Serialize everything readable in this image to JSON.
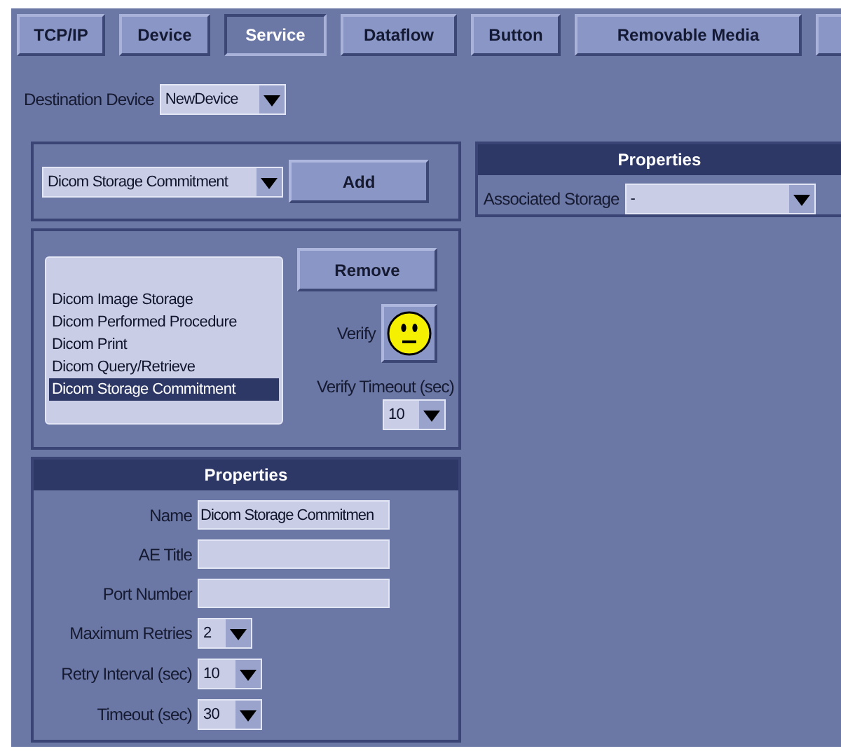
{
  "tabs": [
    {
      "label": "TCP/IP",
      "selected": false
    },
    {
      "label": "Device",
      "selected": false
    },
    {
      "label": "Service",
      "selected": true
    },
    {
      "label": "Dataflow",
      "selected": false
    },
    {
      "label": "Button",
      "selected": false
    },
    {
      "label": "Removable Media",
      "selected": false
    }
  ],
  "destination": {
    "label": "Destination Device",
    "value": "NewDevice"
  },
  "add_panel": {
    "service_type": "Dicom Storage Commitment",
    "add_button": "Add"
  },
  "service_list": {
    "items": [
      {
        "label": "Dicom Image Storage",
        "selected": false
      },
      {
        "label": "Dicom Performed Procedure",
        "selected": false
      },
      {
        "label": "Dicom Print",
        "selected": false
      },
      {
        "label": "Dicom Query/Retrieve",
        "selected": false
      },
      {
        "label": "Dicom Storage Commitment",
        "selected": true
      }
    ],
    "remove_button": "Remove",
    "verify_label": "Verify",
    "verify_timeout_label": "Verify Timeout (sec)",
    "verify_timeout": "10"
  },
  "properties": {
    "title": "Properties",
    "fields": [
      {
        "kind": "text",
        "label": "Name",
        "value": "Dicom Storage Commitmen"
      },
      {
        "kind": "text",
        "label": "AE Title"
      },
      {
        "kind": "text",
        "label": "Port Number"
      },
      {
        "kind": "select",
        "label": "Maximum Retries",
        "value": "2"
      },
      {
        "kind": "select",
        "label": "Retry Interval (sec)",
        "value": "10"
      },
      {
        "kind": "select",
        "label": "Timeout (sec)",
        "value": "30"
      }
    ]
  },
  "associated_properties": {
    "title": "Properties",
    "label": "Associated Storage",
    "value": "-"
  }
}
